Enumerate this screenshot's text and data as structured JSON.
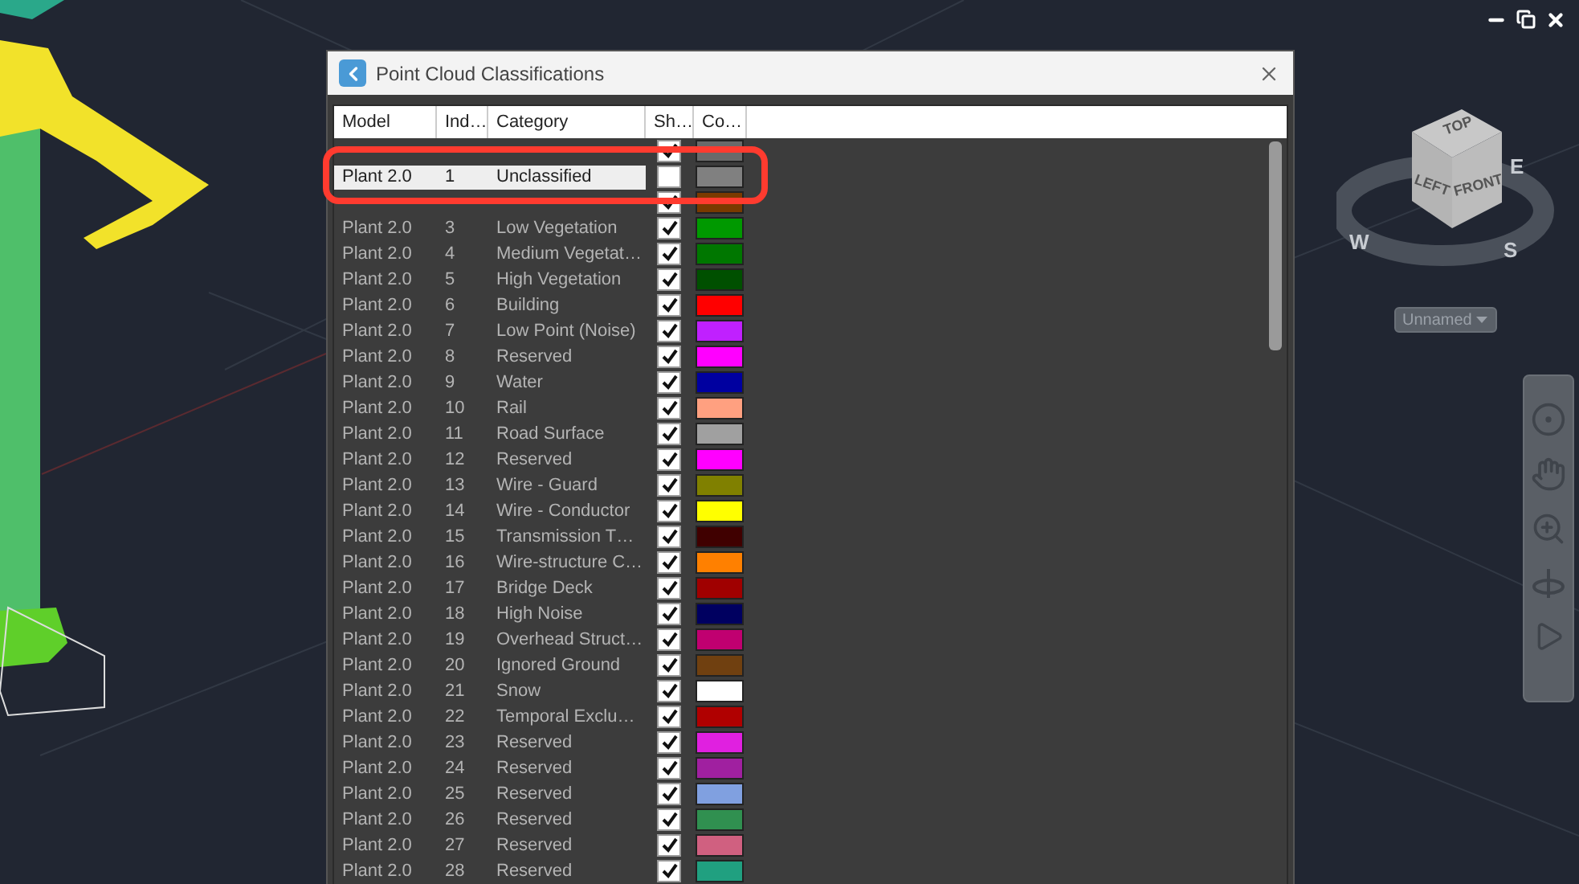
{
  "dialog": {
    "title": "Point Cloud Classifications",
    "columns": [
      "Model",
      "Ind…",
      "Category",
      "Sh…",
      "Co…"
    ],
    "rows": [
      {
        "kind": "partial",
        "checked": true,
        "selected": false,
        "color": "#6a6a6a"
      },
      {
        "kind": "full",
        "model": "Plant 2.0",
        "index": "1",
        "category": "Unclassified",
        "checked": false,
        "selected": true,
        "color": "#808080"
      },
      {
        "kind": "partial",
        "checked": true,
        "selected": false,
        "color": "#7a3a00"
      },
      {
        "kind": "full",
        "model": "Plant 2.0",
        "index": "3",
        "category": "Low Vegetation",
        "checked": true,
        "selected": false,
        "color": "#009900"
      },
      {
        "kind": "full",
        "model": "Plant 2.0",
        "index": "4",
        "category": "Medium Vegetat…",
        "checked": true,
        "selected": false,
        "color": "#007700"
      },
      {
        "kind": "full",
        "model": "Plant 2.0",
        "index": "5",
        "category": "High Vegetation",
        "checked": true,
        "selected": false,
        "color": "#005000"
      },
      {
        "kind": "full",
        "model": "Plant 2.0",
        "index": "6",
        "category": "Building",
        "checked": true,
        "selected": false,
        "color": "#ff0000"
      },
      {
        "kind": "full",
        "model": "Plant 2.0",
        "index": "7",
        "category": "Low Point (Noise)",
        "checked": true,
        "selected": false,
        "color": "#c020ff"
      },
      {
        "kind": "full",
        "model": "Plant 2.0",
        "index": "8",
        "category": "Reserved",
        "checked": true,
        "selected": false,
        "color": "#ff00ff"
      },
      {
        "kind": "full",
        "model": "Plant 2.0",
        "index": "9",
        "category": "Water",
        "checked": true,
        "selected": false,
        "color": "#0000a0"
      },
      {
        "kind": "full",
        "model": "Plant 2.0",
        "index": "10",
        "category": "Rail",
        "checked": true,
        "selected": false,
        "color": "#ffa080"
      },
      {
        "kind": "full",
        "model": "Plant 2.0",
        "index": "11",
        "category": "Road Surface",
        "checked": true,
        "selected": false,
        "color": "#a0a0a0"
      },
      {
        "kind": "full",
        "model": "Plant 2.0",
        "index": "12",
        "category": "Reserved",
        "checked": true,
        "selected": false,
        "color": "#ff00ff"
      },
      {
        "kind": "full",
        "model": "Plant 2.0",
        "index": "13",
        "category": "Wire - Guard",
        "checked": true,
        "selected": false,
        "color": "#808000"
      },
      {
        "kind": "full",
        "model": "Plant 2.0",
        "index": "14",
        "category": "Wire - Conductor",
        "checked": true,
        "selected": false,
        "color": "#ffff00"
      },
      {
        "kind": "full",
        "model": "Plant 2.0",
        "index": "15",
        "category": "Transmission T…",
        "checked": true,
        "selected": false,
        "color": "#400000"
      },
      {
        "kind": "full",
        "model": "Plant 2.0",
        "index": "16",
        "category": "Wire-structure C…",
        "checked": true,
        "selected": false,
        "color": "#ff8000"
      },
      {
        "kind": "full",
        "model": "Plant 2.0",
        "index": "17",
        "category": "Bridge Deck",
        "checked": true,
        "selected": false,
        "color": "#a00000"
      },
      {
        "kind": "full",
        "model": "Plant 2.0",
        "index": "18",
        "category": "High Noise",
        "checked": true,
        "selected": false,
        "color": "#000060"
      },
      {
        "kind": "full",
        "model": "Plant 2.0",
        "index": "19",
        "category": "Overhead Struct…",
        "checked": true,
        "selected": false,
        "color": "#c00070"
      },
      {
        "kind": "full",
        "model": "Plant 2.0",
        "index": "20",
        "category": "Ignored Ground",
        "checked": true,
        "selected": false,
        "color": "#704010"
      },
      {
        "kind": "full",
        "model": "Plant 2.0",
        "index": "21",
        "category": "Snow",
        "checked": true,
        "selected": false,
        "color": "#ffffff"
      },
      {
        "kind": "full",
        "model": "Plant 2.0",
        "index": "22",
        "category": "Temporal Exclu…",
        "checked": true,
        "selected": false,
        "color": "#b00000"
      },
      {
        "kind": "full",
        "model": "Plant 2.0",
        "index": "23",
        "category": "Reserved",
        "checked": true,
        "selected": false,
        "color": "#e020e0"
      },
      {
        "kind": "full",
        "model": "Plant 2.0",
        "index": "24",
        "category": "Reserved",
        "checked": true,
        "selected": false,
        "color": "#a020a0"
      },
      {
        "kind": "full",
        "model": "Plant 2.0",
        "index": "25",
        "category": "Reserved",
        "checked": true,
        "selected": false,
        "color": "#80a0e0"
      },
      {
        "kind": "full",
        "model": "Plant 2.0",
        "index": "26",
        "category": "Reserved",
        "checked": true,
        "selected": false,
        "color": "#309050"
      },
      {
        "kind": "full",
        "model": "Plant 2.0",
        "index": "27",
        "category": "Reserved",
        "checked": true,
        "selected": false,
        "color": "#d06080"
      },
      {
        "kind": "full",
        "model": "Plant 2.0",
        "index": "28",
        "category": "Reserved",
        "checked": true,
        "selected": false,
        "color": "#20a080"
      }
    ]
  },
  "viewcube": {
    "faces": [
      "TOP",
      "LEFT",
      "FRONT"
    ],
    "compass": [
      "W",
      "E",
      "S"
    ],
    "view_menu": "Unnamed"
  }
}
